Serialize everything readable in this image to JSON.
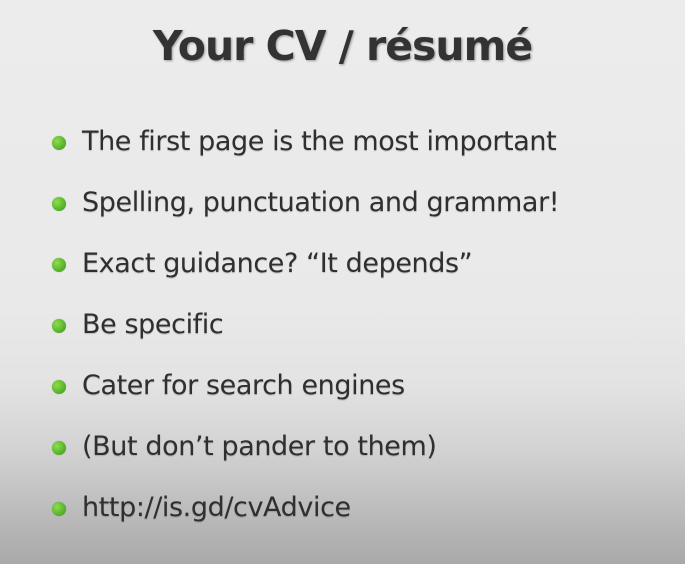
{
  "slide": {
    "title": "Your CV / résumé",
    "bullets": [
      "The first page is the most important",
      "Spelling, punctuation and grammar!",
      "Exact guidance? “It depends”",
      "Be specific",
      "Cater for search engines",
      "(But don’t pander to them)",
      "http://is.gd/cvAdvice"
    ],
    "colors": {
      "bullet": "#5cb82c",
      "text": "#2f2f2f",
      "title": "#333333"
    }
  }
}
